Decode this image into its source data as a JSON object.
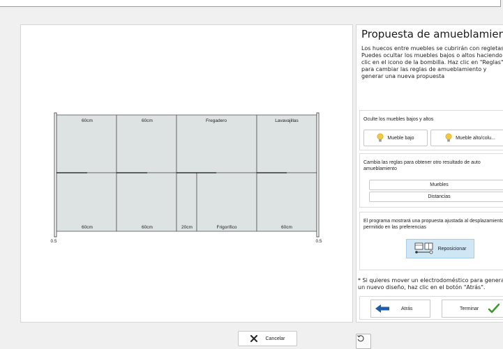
{
  "plan": {
    "upper_cabinets": [
      {
        "label": "60cm"
      },
      {
        "label": "60cm"
      },
      {
        "label": "Fregadero"
      },
      {
        "label": "Lavavajillas"
      }
    ],
    "lower_cabinets": [
      {
        "label": "60cm"
      },
      {
        "label": "60cm"
      },
      {
        "label": "20cm"
      },
      {
        "label": "Frigorífico"
      },
      {
        "label": "60cm"
      }
    ],
    "left_offset": "0.5",
    "right_offset": "0.5"
  },
  "panel": {
    "title": "Propuesta de amueblamiento",
    "description": "Los huecos entre muebles se cubrirán con regletas. Puedes ocultar los muebles bajos o altos haciendo clic en el icono de la bombilla. Haz clic en \"Reglas\" para cambiar las reglas de amueblamiento y generar una nueva propuesta",
    "hide_section": {
      "label": "Oculte los muebles bajos y altos",
      "low_button": "Mueble bajo",
      "high_button": "Mueble alto/colu..."
    },
    "rules_section": {
      "label": "Cambia las reglas para obtener otro resultado de auto amueblamiento",
      "furniture_button": "Muebles",
      "distances_button": "Distancias"
    },
    "reposition_section": {
      "label": "El programa mostrará una propuesta ajustada al desplazamiento permitido en las preferencias",
      "button": "Reposicionar"
    },
    "note": "* Si quieres mover un electrodoméstico para generar un nuevo diseño, haz clic en el botón \"Atrás\".",
    "back_button": "Atrás",
    "finish_button": "Terminar"
  },
  "footer": {
    "cancel_button": "Cancelar"
  },
  "icons": {
    "reset": "rotate-ccw-icon",
    "bulb": "lightbulb-icon",
    "back": "arrow-left-icon",
    "finish": "checkmark-icon",
    "cancel": "close-x-icon",
    "reposition": "reposition-icon"
  },
  "colors": {
    "cabinet_fill": "#dde3e3",
    "bulb": "#f5c842",
    "back_arrow": "#1d5ea8",
    "check": "#3e9a2e",
    "cancel_x": "#2b2b2b",
    "reposition_bg": "#cfe6f5"
  }
}
